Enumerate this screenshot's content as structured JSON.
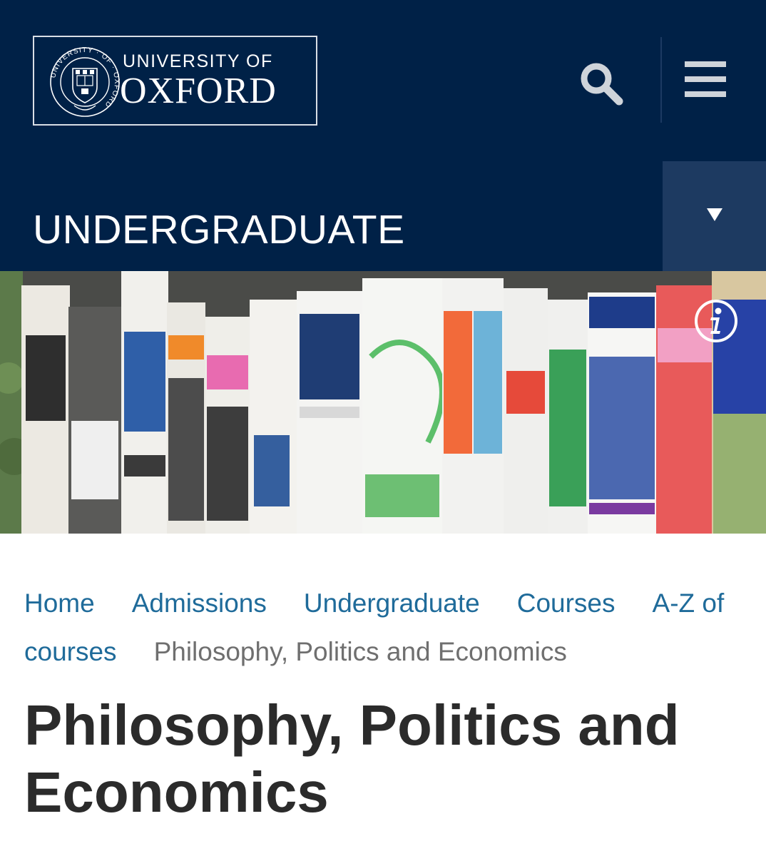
{
  "header": {
    "logo_line1": "UNIVERSITY OF",
    "logo_line2": "OXFORD",
    "crest_text": "UNIVERSITY · OF · OXFORD",
    "search_icon": "search-icon",
    "menu_icon": "hamburger-menu-icon"
  },
  "section": {
    "title": "UNDERGRADUATE",
    "toggle_icon": "caret-down-icon"
  },
  "hero": {
    "image": "rolled-newspapers-photo",
    "info_icon": "info-icon"
  },
  "breadcrumb": {
    "items": [
      "Home",
      "Admissions",
      "Undergraduate",
      "Courses",
      "A-Z of courses"
    ],
    "current": "Philosophy, Politics and Economics"
  },
  "page": {
    "title": "Philosophy, Politics and Economics"
  },
  "colors": {
    "oxford_blue": "#002147",
    "toggle_blue": "#1d3a61",
    "link_blue": "#1f6b9a",
    "breadcrumb_current": "#6f6f6f",
    "title_text": "#2b2b2b"
  }
}
